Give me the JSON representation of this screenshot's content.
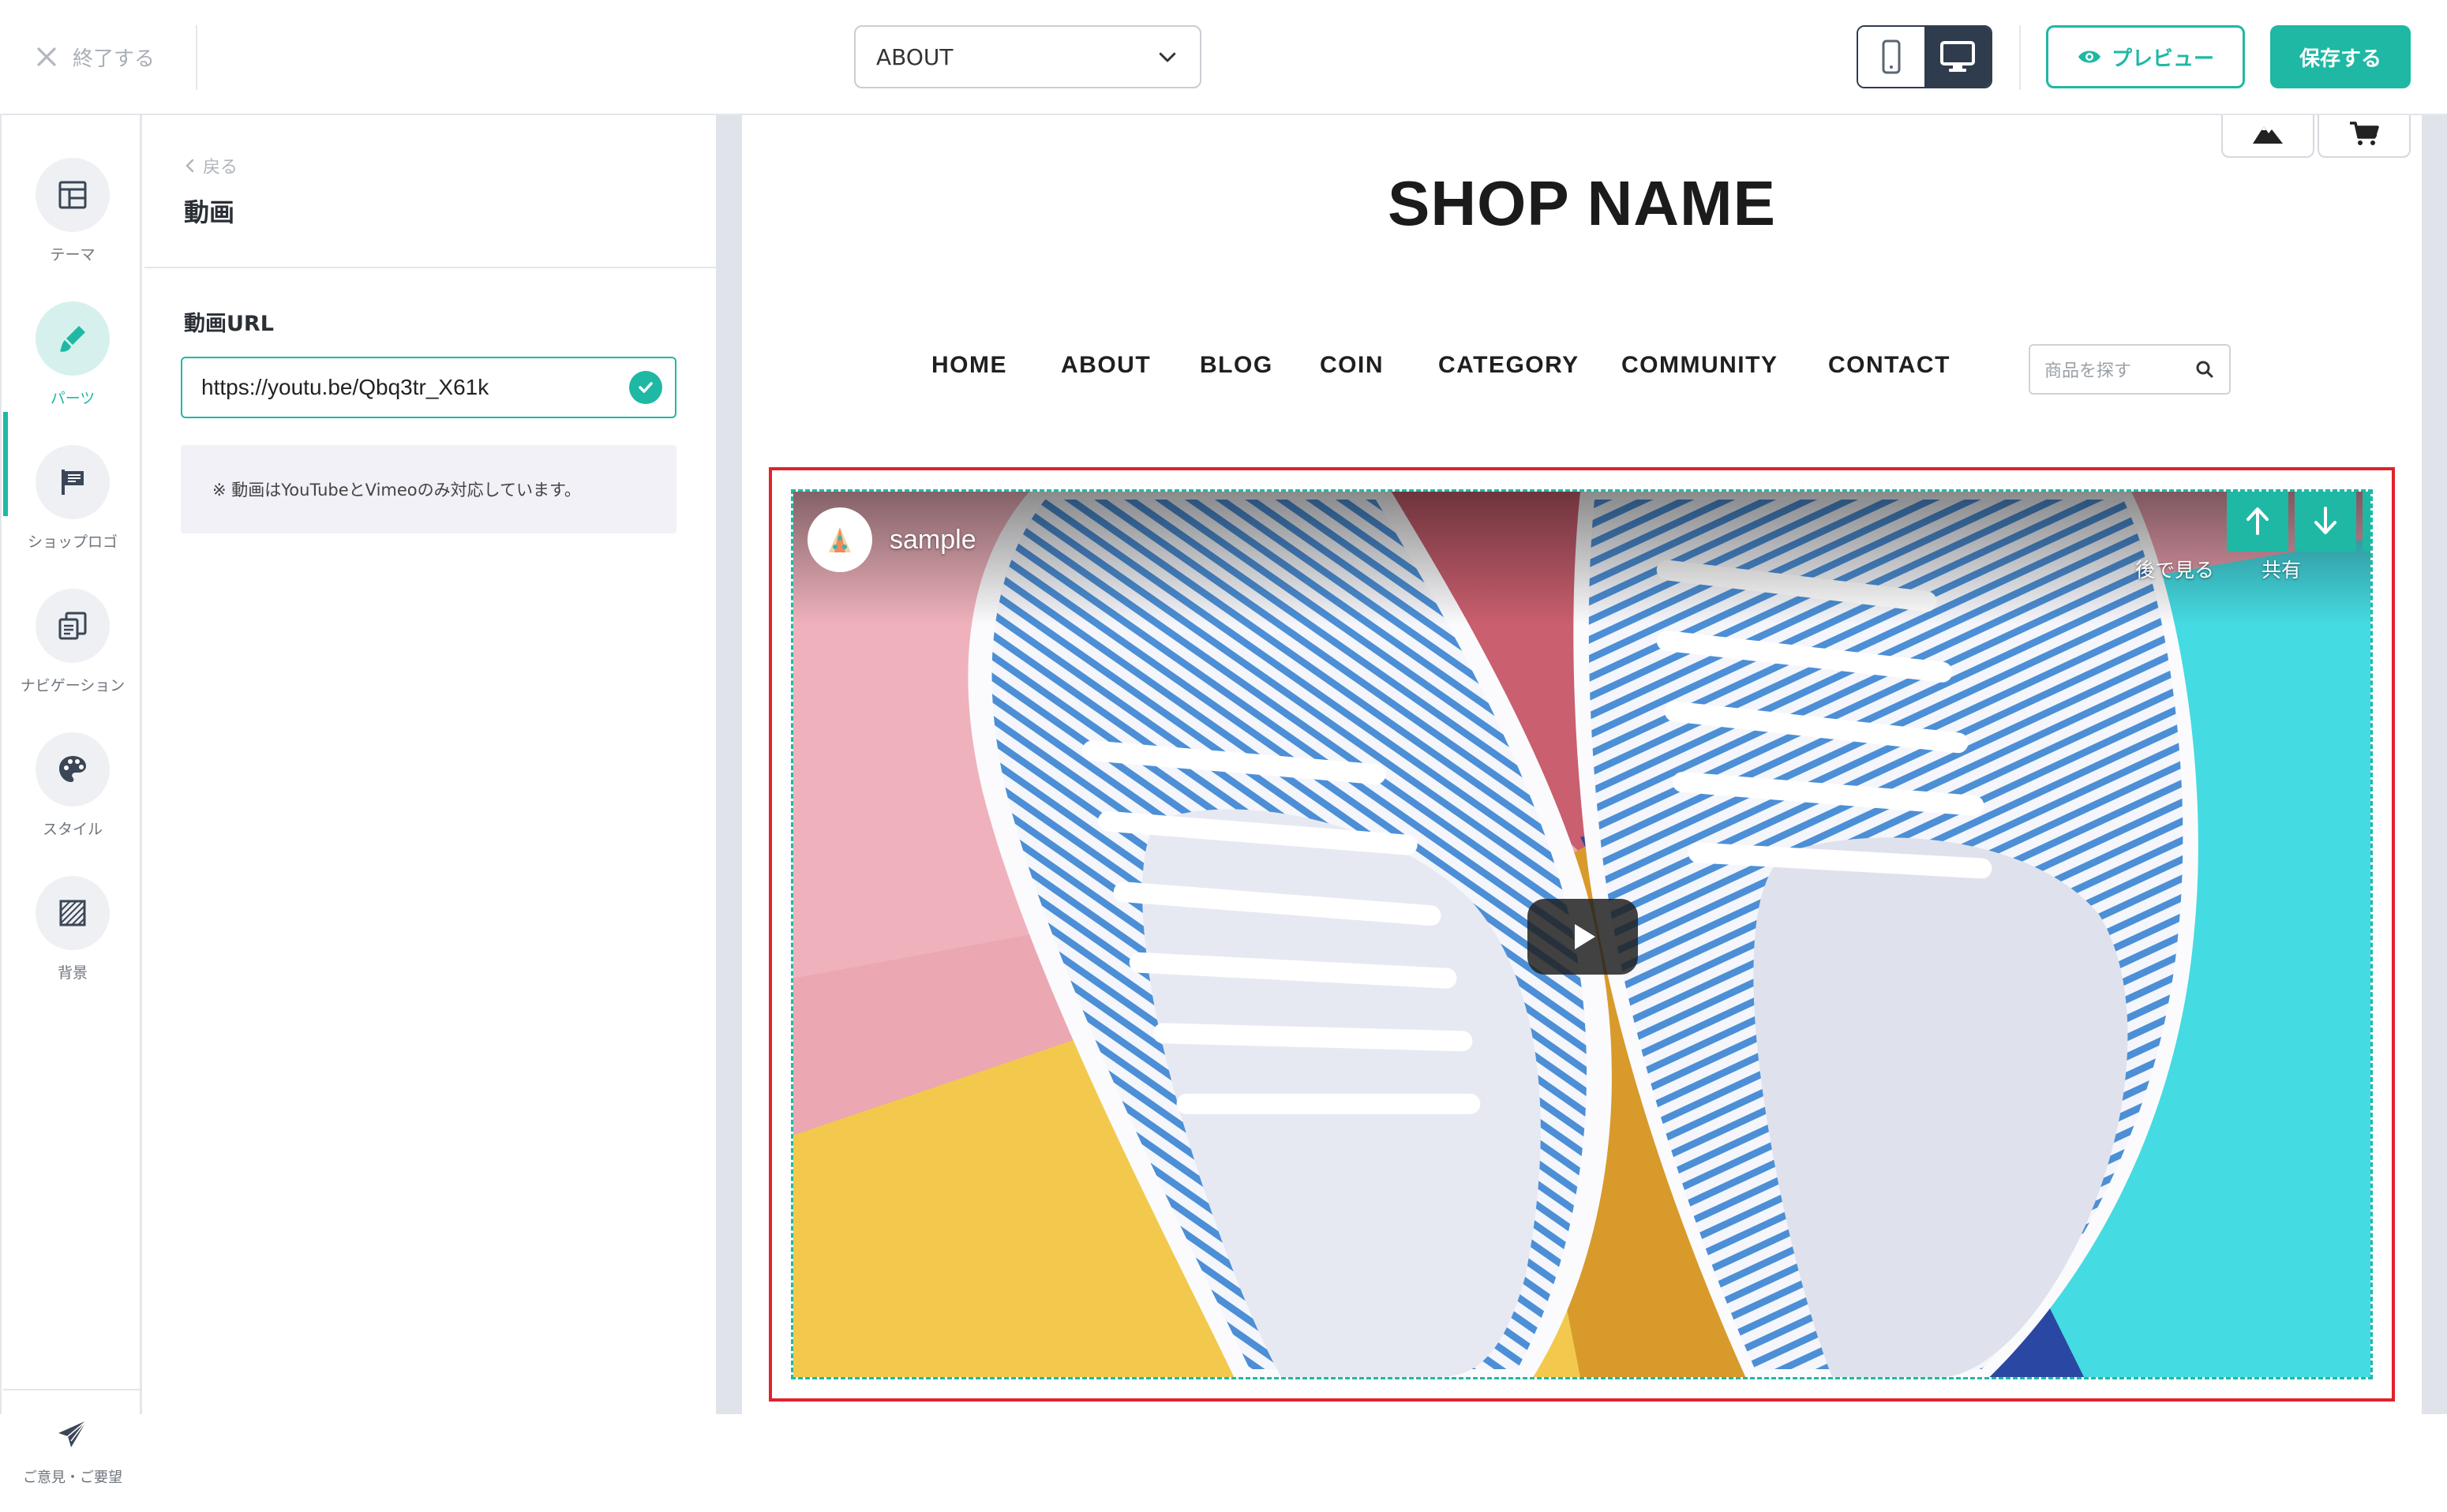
{
  "header": {
    "exit_label": "終了する",
    "page_select_value": "ABOUT",
    "preview_label": "プレビュー",
    "save_label": "保存する"
  },
  "rail": {
    "items": [
      {
        "label": "テーマ",
        "icon": "layout-icon"
      },
      {
        "label": "パーツ",
        "icon": "brush-icon"
      },
      {
        "label": "ショップロゴ",
        "icon": "signboard-icon"
      },
      {
        "label": "ナビゲーション",
        "icon": "navigation-icon"
      },
      {
        "label": "スタイル",
        "icon": "palette-icon"
      },
      {
        "label": "背景",
        "icon": "pattern-icon"
      }
    ],
    "active_index": 1,
    "feedback_label": "ご意見・ご要望"
  },
  "panel": {
    "back_label": "戻る",
    "title": "動画",
    "url_label": "動画URL",
    "url_value": "https://youtu.be/Qbq3tr_X61k",
    "note": "※ 動画はYouTubeとVimeoのみ対応しています。"
  },
  "preview": {
    "shop_name": "SHOP NAME",
    "nav": [
      "HOME",
      "ABOUT",
      "BLOG",
      "COIN",
      "CATEGORY",
      "COMMUNITY",
      "CONTACT"
    ],
    "search_placeholder": "商品を探す",
    "video": {
      "channel_title": "sample",
      "watch_later": "後で見る",
      "share": "共有"
    }
  },
  "colors": {
    "accent": "#1fb8a4",
    "dark": "#2f3c4d",
    "selection": "#e2222a"
  }
}
